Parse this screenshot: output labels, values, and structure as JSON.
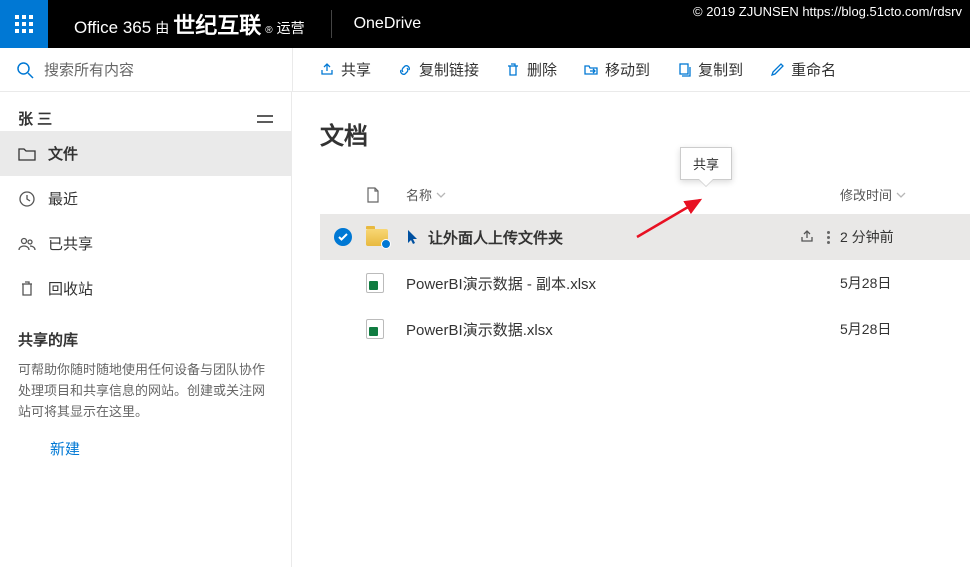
{
  "watermark": "© 2019 ZJUNSEN https://blog.51cto.com/rdsrv",
  "topbar": {
    "brand_prefix": "Office 365",
    "brand_by": "由",
    "brand_vendor": "世纪互联",
    "brand_tm": "®",
    "brand_suffix": "运营",
    "appname": "OneDrive"
  },
  "search": {
    "placeholder": "搜索所有内容"
  },
  "commands": {
    "share": "共享",
    "copylink": "复制链接",
    "delete": "删除",
    "moveto": "移动到",
    "copyto": "复制到",
    "rename": "重命名"
  },
  "sidebar": {
    "username": "张 三",
    "items": {
      "files": "文件",
      "recent": "最近",
      "shared": "已共享",
      "recycle": "回收站"
    },
    "libs_title": "共享的库",
    "libs_help": "可帮助你随时随地使用任何设备与团队协作处理项目和共享信息的网站。创建或关注网站可将其显示在这里。",
    "new_link": "新建"
  },
  "main": {
    "title": "文档",
    "cols": {
      "name": "名称",
      "modified": "修改时间"
    },
    "tooltip": "共享",
    "rows": [
      {
        "name": "让外面人上传文件夹",
        "modified": "2 分钟前",
        "type": "folder-shared",
        "selected": true
      },
      {
        "name": "PowerBI演示数据 - 副本.xlsx",
        "modified": "5月28日",
        "type": "xlsx",
        "selected": false
      },
      {
        "name": "PowerBI演示数据.xlsx",
        "modified": "5月28日",
        "type": "xlsx",
        "selected": false
      }
    ]
  }
}
